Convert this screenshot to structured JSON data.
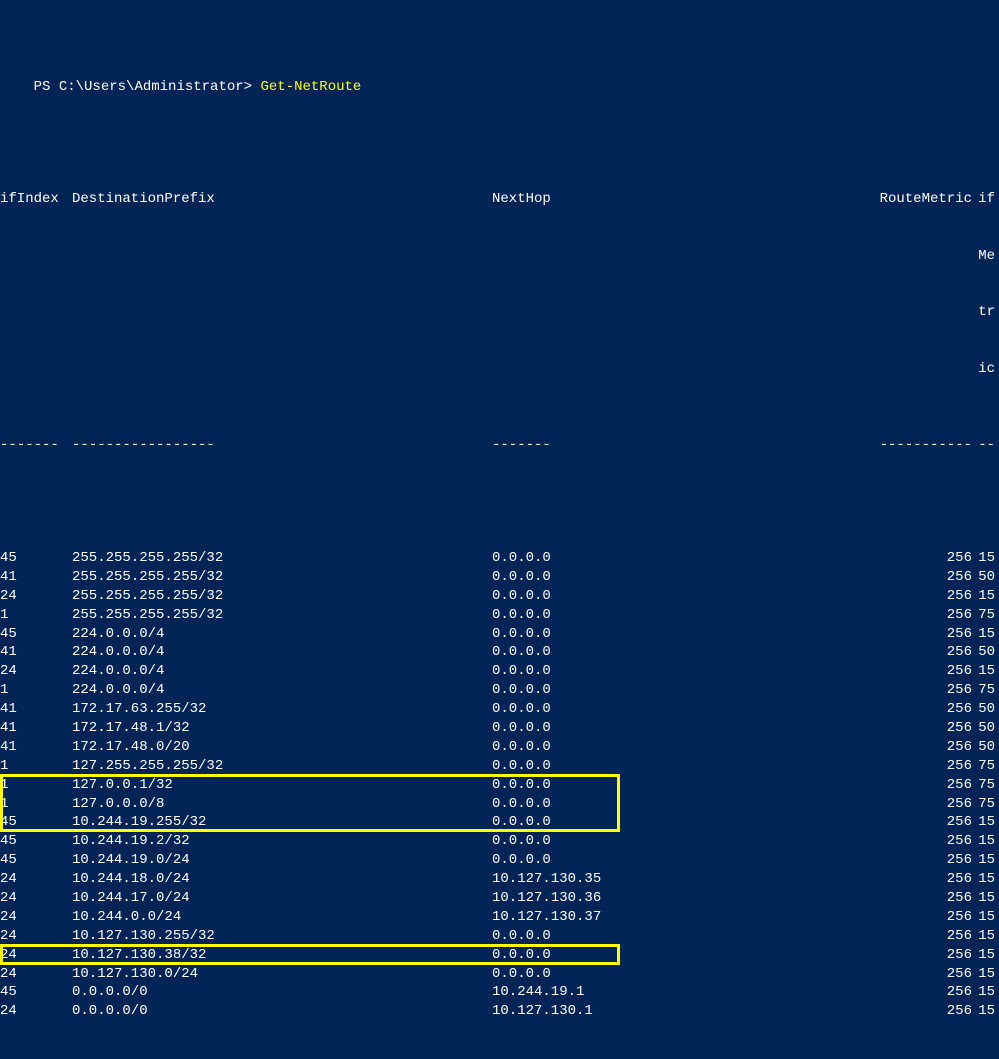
{
  "prompt": {
    "prefix": "PS ",
    "path": "C:\\Users\\Administrator",
    "arrow": "> ",
    "command": "Get-NetRoute"
  },
  "headers": {
    "ifIndex": "ifIndex",
    "destinationPrefix": "DestinationPrefix",
    "nextHop": "NextHop",
    "routeMetric": "RouteMetric",
    "ifMetric_wrapped": [
      "if",
      "Me",
      "tr",
      "ic"
    ]
  },
  "dashes": {
    "ifIndex": "-------",
    "destinationPrefix": "-----------------",
    "nextHop": "-------",
    "routeMetric": "-----------",
    "ifMetric": "--"
  },
  "routes": [
    {
      "ifIndex": "45",
      "dest": "255.255.255.255/32",
      "nextHop": "0.0.0.0",
      "routeMetric": "256",
      "ifMetric": "15"
    },
    {
      "ifIndex": "41",
      "dest": "255.255.255.255/32",
      "nextHop": "0.0.0.0",
      "routeMetric": "256",
      "ifMetric": "50"
    },
    {
      "ifIndex": "24",
      "dest": "255.255.255.255/32",
      "nextHop": "0.0.0.0",
      "routeMetric": "256",
      "ifMetric": "15"
    },
    {
      "ifIndex": "1",
      "dest": "255.255.255.255/32",
      "nextHop": "0.0.0.0",
      "routeMetric": "256",
      "ifMetric": "75"
    },
    {
      "ifIndex": "45",
      "dest": "224.0.0.0/4",
      "nextHop": "0.0.0.0",
      "routeMetric": "256",
      "ifMetric": "15"
    },
    {
      "ifIndex": "41",
      "dest": "224.0.0.0/4",
      "nextHop": "0.0.0.0",
      "routeMetric": "256",
      "ifMetric": "50"
    },
    {
      "ifIndex": "24",
      "dest": "224.0.0.0/4",
      "nextHop": "0.0.0.0",
      "routeMetric": "256",
      "ifMetric": "15"
    },
    {
      "ifIndex": "1",
      "dest": "224.0.0.0/4",
      "nextHop": "0.0.0.0",
      "routeMetric": "256",
      "ifMetric": "75"
    },
    {
      "ifIndex": "41",
      "dest": "172.17.63.255/32",
      "nextHop": "0.0.0.0",
      "routeMetric": "256",
      "ifMetric": "50"
    },
    {
      "ifIndex": "41",
      "dest": "172.17.48.1/32",
      "nextHop": "0.0.0.0",
      "routeMetric": "256",
      "ifMetric": "50"
    },
    {
      "ifIndex": "41",
      "dest": "172.17.48.0/20",
      "nextHop": "0.0.0.0",
      "routeMetric": "256",
      "ifMetric": "50"
    },
    {
      "ifIndex": "1",
      "dest": "127.255.255.255/32",
      "nextHop": "0.0.0.0",
      "routeMetric": "256",
      "ifMetric": "75"
    },
    {
      "ifIndex": "1",
      "dest": "127.0.0.1/32",
      "nextHop": "0.0.0.0",
      "routeMetric": "256",
      "ifMetric": "75"
    },
    {
      "ifIndex": "1",
      "dest": "127.0.0.0/8",
      "nextHop": "0.0.0.0",
      "routeMetric": "256",
      "ifMetric": "75"
    },
    {
      "ifIndex": "45",
      "dest": "10.244.19.255/32",
      "nextHop": "0.0.0.0",
      "routeMetric": "256",
      "ifMetric": "15"
    },
    {
      "ifIndex": "45",
      "dest": "10.244.19.2/32",
      "nextHop": "0.0.0.0",
      "routeMetric": "256",
      "ifMetric": "15"
    },
    {
      "ifIndex": "45",
      "dest": "10.244.19.0/24",
      "nextHop": "0.0.0.0",
      "routeMetric": "256",
      "ifMetric": "15"
    },
    {
      "ifIndex": "24",
      "dest": "10.244.18.0/24",
      "nextHop": "10.127.130.35",
      "routeMetric": "256",
      "ifMetric": "15"
    },
    {
      "ifIndex": "24",
      "dest": "10.244.17.0/24",
      "nextHop": "10.127.130.36",
      "routeMetric": "256",
      "ifMetric": "15"
    },
    {
      "ifIndex": "24",
      "dest": "10.244.0.0/24",
      "nextHop": "10.127.130.37",
      "routeMetric": "256",
      "ifMetric": "15"
    },
    {
      "ifIndex": "24",
      "dest": "10.127.130.255/32",
      "nextHop": "0.0.0.0",
      "routeMetric": "256",
      "ifMetric": "15"
    },
    {
      "ifIndex": "24",
      "dest": "10.127.130.38/32",
      "nextHop": "0.0.0.0",
      "routeMetric": "256",
      "ifMetric": "15"
    },
    {
      "ifIndex": "24",
      "dest": "10.127.130.0/24",
      "nextHop": "0.0.0.0",
      "routeMetric": "256",
      "ifMetric": "15"
    },
    {
      "ifIndex": "45",
      "dest": "0.0.0.0/0",
      "nextHop": "10.244.19.1",
      "routeMetric": "256",
      "ifMetric": "15"
    },
    {
      "ifIndex": "24",
      "dest": "0.0.0.0/0",
      "nextHop": "10.127.130.1",
      "routeMetric": "256",
      "ifMetric": "15"
    }
  ],
  "highlights": [
    {
      "startRow": 14,
      "endRow": 16
    },
    {
      "startRow": 23,
      "endRow": 23
    }
  ]
}
